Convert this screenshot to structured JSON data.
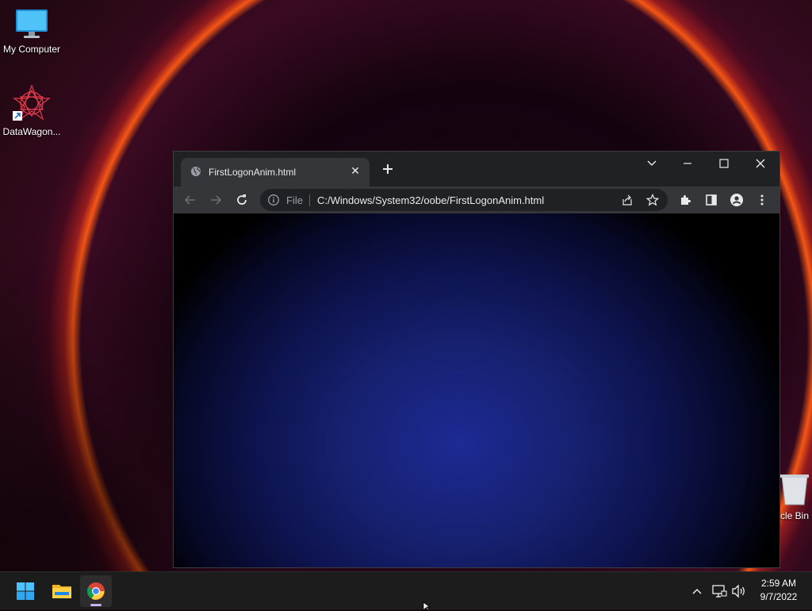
{
  "desktop": {
    "icons": [
      {
        "label": "My Computer"
      },
      {
        "label": "DataWagon..."
      },
      {
        "label": "Recycle Bin"
      }
    ]
  },
  "browser": {
    "tab": {
      "title": "FirstLogonAnim.html",
      "icon": "globe-icon"
    },
    "toolbar": {
      "scheme": "File",
      "url": "C:/Windows/System32/oobe/FirstLogonAnim.html"
    }
  },
  "taskbar": {
    "apps": [
      "start-icon",
      "file-explorer-icon",
      "chrome-icon"
    ],
    "clock": {
      "time": "2:59 AM",
      "date": "9/7/2022"
    }
  },
  "colors": {
    "accent_blue": "#1d2a94",
    "taskbar_bg": "#1c1c1c",
    "tab_active": "#35363a"
  }
}
